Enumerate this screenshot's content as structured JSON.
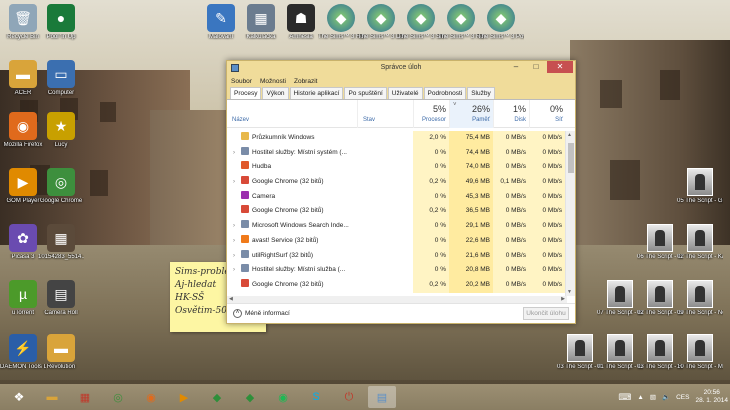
{
  "desktop_icons": [
    {
      "label": "Recycle Bin",
      "icon": "recycle-bin-icon"
    },
    {
      "label": "Pool 'in Up",
      "icon": "pool-game-icon"
    },
    {
      "label": "ACER",
      "icon": "folder-icon"
    },
    {
      "label": "Computer",
      "icon": "computer-icon"
    },
    {
      "label": "Mozilla Firefox",
      "icon": "firefox-icon"
    },
    {
      "label": "Lucy",
      "icon": "star-icon"
    },
    {
      "label": "GOM Player",
      "icon": "gom-player-icon"
    },
    {
      "label": "Google Chrome",
      "icon": "chrome-icon"
    },
    {
      "label": "Picasa 3",
      "icon": "picasa-icon"
    },
    {
      "label": "10154283_5514...",
      "icon": "photo-icon"
    },
    {
      "label": "uTorrent",
      "icon": "utorrent-icon"
    },
    {
      "label": "Camera Roll",
      "icon": "camera-roll-icon"
    },
    {
      "label": "DAEMON Tools Lite",
      "icon": "daemon-tools-icon"
    },
    {
      "label": "Revolution",
      "icon": "folder-icon"
    },
    {
      "label": "Malování",
      "icon": "paint-icon"
    },
    {
      "label": "Kalkulačka",
      "icon": "calculator-icon"
    },
    {
      "label": "Amnesia",
      "icon": "amnesia-icon"
    },
    {
      "label": "The Sims™ 3 Hodiny osudu",
      "icon": "sims-icon"
    },
    {
      "label": "The Sims™ 3 Domácí m...",
      "icon": "sims-icon"
    },
    {
      "label": "The Sims™ 3 Showtime",
      "icon": "sims-icon"
    },
    {
      "label": "The Sims™ 3 Roční období",
      "icon": "sims-icon"
    },
    {
      "label": "The Sims™ 3 Povolání snů",
      "icon": "sims-icon"
    }
  ],
  "right_icons": [
    {
      "label": "05 The Script - Glowing"
    },
    {
      "label": "06 The Script - Give The ..."
    },
    {
      "label": "02 The Script - Kaleidosc..."
    },
    {
      "label": "07 The Script - Broken A..."
    },
    {
      "label": "02 The Script - Six Degre..."
    },
    {
      "label": "09 The Script - No Words"
    },
    {
      "label": "03 The Script - If You Co..."
    },
    {
      "label": "01 The Script - Good Ol'..."
    },
    {
      "label": "03 The Script - Hall Of F..."
    },
    {
      "label": "10 The Script - Millionaires"
    }
  ],
  "sticky_note": {
    "lines": [
      "Sims-problem",
      "Aj-hledat",
      "HK-SŠ",
      "Osvětim-50Ø"
    ]
  },
  "task_manager": {
    "title": "Správce úloh",
    "menu": [
      "Soubor",
      "Možnosti",
      "Zobrazit"
    ],
    "tabs": [
      "Procesy",
      "Výkon",
      "Historie aplikací",
      "Po spuštění",
      "Uživatelé",
      "Podrobnosti",
      "Služby"
    ],
    "active_tab": "Procesy",
    "columns": {
      "name": "Název",
      "status": "Stav",
      "cpu": {
        "pct": "5%",
        "label": "Procesor"
      },
      "memory": {
        "pct": "26%",
        "label": "Paměť"
      },
      "disk": {
        "pct": "1%",
        "label": "Disk"
      },
      "network": {
        "pct": "0%",
        "label": "Síť"
      }
    },
    "processes": [
      {
        "name": "Průzkumník Windows",
        "expand": false,
        "icon": "explorer-icon",
        "color": "#e8b84a",
        "cpu": "2,0 %",
        "mem": "75,4 MB",
        "disk": "0 MB/s",
        "net": "0 Mb/s"
      },
      {
        "name": "Hostitel služby: Místní systém (...",
        "expand": true,
        "icon": "service-host-icon",
        "color": "#7a8ca8",
        "cpu": "0 %",
        "mem": "74,4 MB",
        "disk": "0 MB/s",
        "net": "0 Mb/s"
      },
      {
        "name": "Hudba",
        "expand": false,
        "icon": "music-icon",
        "color": "#e0582a",
        "cpu": "0 %",
        "mem": "74,0 MB",
        "disk": "0 MB/s",
        "net": "0 Mb/s"
      },
      {
        "name": "Google Chrome (32 bitů)",
        "expand": true,
        "icon": "chrome-icon",
        "color": "#d84a38",
        "cpu": "0,2 %",
        "mem": "49,6 MB",
        "disk": "0,1 MB/s",
        "net": "0 Mb/s"
      },
      {
        "name": "Camera",
        "expand": false,
        "icon": "camera-icon",
        "color": "#9b2fae",
        "cpu": "0 %",
        "mem": "45,3 MB",
        "disk": "0 MB/s",
        "net": "0 Mb/s"
      },
      {
        "name": "Google Chrome (32 bitů)",
        "expand": false,
        "icon": "chrome-icon",
        "color": "#d84a38",
        "cpu": "0,2 %",
        "mem": "36,5 MB",
        "disk": "0 MB/s",
        "net": "0 Mb/s"
      },
      {
        "name": "Microsoft Windows Search Inde...",
        "expand": true,
        "icon": "search-indexer-icon",
        "color": "#7a8ca8",
        "cpu": "0 %",
        "mem": "29,1 MB",
        "disk": "0 MB/s",
        "net": "0 Mb/s"
      },
      {
        "name": "avast! Service (32 bitů)",
        "expand": true,
        "icon": "avast-icon",
        "color": "#f07a1a",
        "cpu": "0 %",
        "mem": "22,6 MB",
        "disk": "0 MB/s",
        "net": "0 Mb/s"
      },
      {
        "name": "utilRightSurf (32 bitů)",
        "expand": true,
        "icon": "app-icon",
        "color": "#7a8ca8",
        "cpu": "0 %",
        "mem": "21,6 MB",
        "disk": "0 MB/s",
        "net": "0 Mb/s"
      },
      {
        "name": "Hostitel služby: Místní služba (...",
        "expand": true,
        "icon": "service-host-icon",
        "color": "#7a8ca8",
        "cpu": "0 %",
        "mem": "20,8 MB",
        "disk": "0 MB/s",
        "net": "0 Mb/s"
      },
      {
        "name": "Google Chrome (32 bitů)",
        "expand": false,
        "icon": "chrome-icon",
        "color": "#d84a38",
        "cpu": "0,2 %",
        "mem": "20,2 MB",
        "disk": "0 MB/s",
        "net": "0 Mb/s"
      }
    ],
    "fewer_details": "Méně informací",
    "end_task": "Ukončit úlohu"
  },
  "taskbar": {
    "items": [
      "file-explorer-icon",
      "apps-icon",
      "chrome-icon",
      "firefox-icon",
      "media-player-icon",
      "sims-icon",
      "sims-icon",
      "spotify-icon",
      "skype-icon",
      "power-icon",
      "task-manager-icon"
    ],
    "active_index": 10,
    "language": "CES",
    "time": "20:56",
    "date": "28. 1. 2014"
  }
}
